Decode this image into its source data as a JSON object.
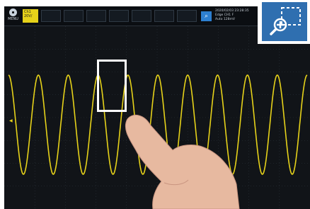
{
  "menu": {
    "label": "MENU"
  },
  "channels": [
    {
      "id": "ch1",
      "label": "Ch1",
      "sub": "20V/"
    },
    {
      "id": "ch2",
      "label": ""
    },
    {
      "id": "ch3",
      "label": ""
    },
    {
      "id": "ch4",
      "label": ""
    },
    {
      "id": "ch5",
      "label": ""
    },
    {
      "id": "ch6",
      "label": ""
    },
    {
      "id": "ch7",
      "label": ""
    },
    {
      "id": "ch8",
      "label": ""
    }
  ],
  "status": {
    "line1": "2020/02/03 23:28:35",
    "line2": "Edge CH1 F",
    "line3": "Auto 128mV"
  },
  "waveform": {
    "cycles": 10,
    "color": "#e6d21a"
  },
  "colors": {
    "screen": "#111418",
    "accent": "#2f6fb0",
    "trace": "#e6d21a"
  },
  "icons": {
    "zoom": "zoom-in-icon",
    "menu": "menu-icon",
    "trigger": "trigger-icon"
  }
}
